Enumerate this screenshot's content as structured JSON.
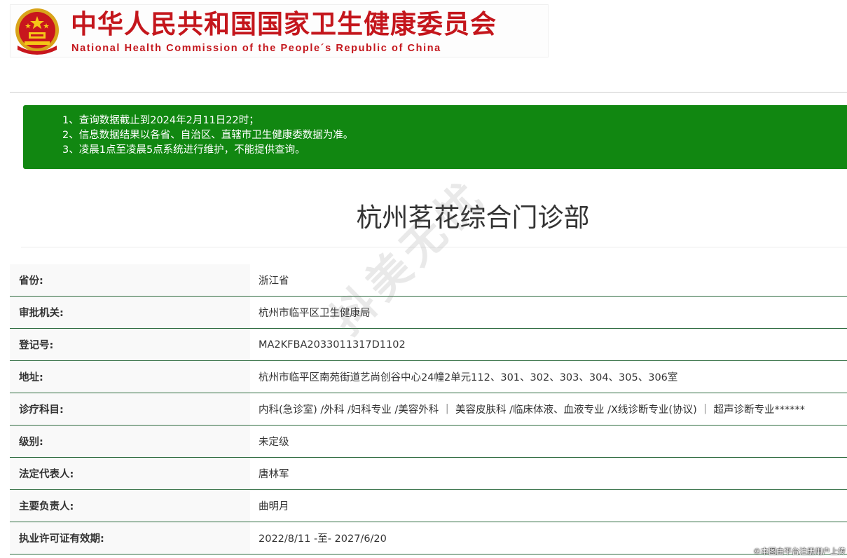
{
  "header": {
    "cn_title": "中华人民共和国国家卫生健康委员会",
    "en_title": "National Health Commission of the People´s Republic of China",
    "emblem_icon": "national-emblem-icon"
  },
  "notice": {
    "lines": [
      "1、查询数据截止到2024年2月11日22时；",
      "2、信息数据结果以各省、自治区、直辖市卫生健康委数据为准。",
      "3、凌晨1点至凌晨5点系统进行维护，不能提供查询。"
    ]
  },
  "clinic": {
    "name": "杭州茗花综合门诊部"
  },
  "rows": [
    {
      "label": "省份:",
      "value": "浙江省"
    },
    {
      "label": "审批机关:",
      "value": "杭州市临平区卫生健康局"
    },
    {
      "label": "登记号:",
      "value": "MA2KFBA2033011317D1102"
    },
    {
      "label": "地址:",
      "value": "杭州市临平区南苑街道艺尚创谷中心24幢2单元112、301、302、303、304、305、306室"
    },
    {
      "label": "诊疗科目:",
      "value": "内科(急诊室) /外科 /妇科专业 /美容外科 ｜ 美容皮肤科 /临床体液、血液专业 /X线诊断专业(协议) ｜ 超声诊断专业******"
    },
    {
      "label": "级别:",
      "value": "未定级"
    },
    {
      "label": "法定代表人:",
      "value": "唐林军"
    },
    {
      "label": "主要负责人:",
      "value": "曲明月"
    },
    {
      "label": "执业许可证有效期:",
      "value": "2022/8/11 -至- 2027/6/20"
    }
  ],
  "watermark": "抖美无忧",
  "footer_note": "©本图由平台注册用户上传",
  "colors": {
    "brand_red": "#c4161c",
    "notice_green": "#118711",
    "row_border": "#2e6b3f"
  }
}
